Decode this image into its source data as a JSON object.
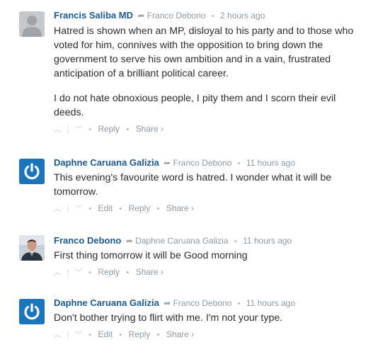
{
  "comments": [
    {
      "author": "Francis Saliba MD",
      "reply_to": "Franco Debono",
      "time": "2 hours ago",
      "avatar": "default-avatar",
      "paragraphs": [
        "Hatred is shown when an MP, disloyal to his party and to those who voted for him, connives with the opposition to bring down the government to serve his own ambition and in a vain, frustrated anticipation of a brilliant political career.",
        "I do not hate obnoxious people, I pity them and I scorn their evil deeds."
      ],
      "actions": [
        "Reply",
        "Share ›"
      ]
    },
    {
      "author": "Daphne Caruana Galizia",
      "reply_to": "Franco Debono",
      "time": "11 hours ago",
      "avatar": "power-logo-avatar",
      "paragraphs": [
        "This evening's favourite word is hatred. I wonder what it will be tomorrow."
      ],
      "actions": [
        "Edit",
        "Reply",
        "Share ›"
      ]
    },
    {
      "author": "Franco Debono",
      "reply_to": "Daphne Caruana Galizia",
      "time": "11 hours ago",
      "avatar": "photo-avatar",
      "paragraphs": [
        "First thing tomorrow it will be Good morning"
      ],
      "actions": [
        "Reply",
        "Share ›"
      ]
    },
    {
      "author": "Daphne Caruana Galizia",
      "reply_to": "Franco Debono",
      "time": "11 hours ago",
      "avatar": "power-logo-avatar",
      "paragraphs": [
        "Don't bother trying to flirt with me. I'm not your type."
      ],
      "actions": [
        "Edit",
        "Reply",
        "Share ›"
      ]
    }
  ],
  "icons": {
    "upvote": "chevron-up-icon",
    "downvote": "chevron-down-icon",
    "reply_arrow": "reply-arrow-icon"
  },
  "colors": {
    "author": "#1a5a91",
    "meta": "#8a9aa5",
    "avatar_blue": "#1a75bb"
  }
}
